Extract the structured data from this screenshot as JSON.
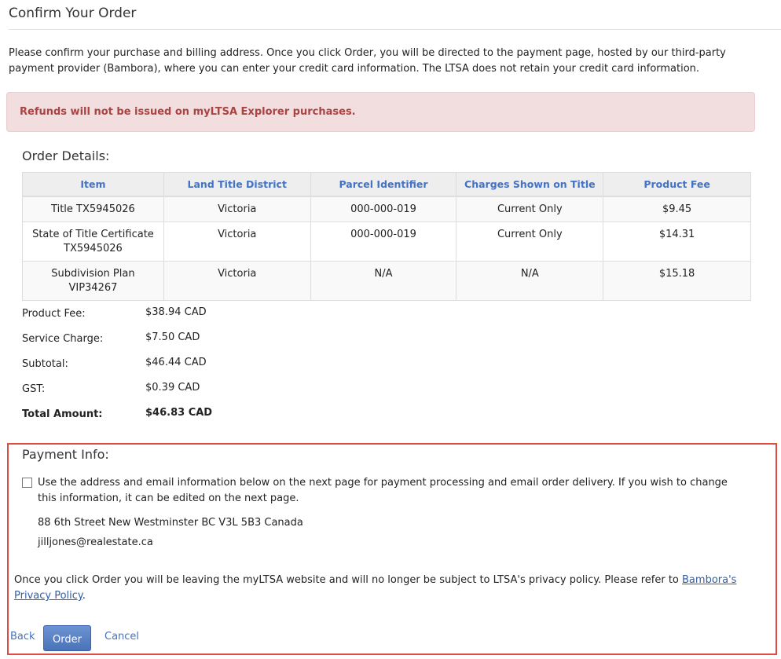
{
  "page": {
    "title": "Confirm Your Order",
    "intro": "Please confirm your purchase and billing address. Once you click Order, you will be directed to the payment page, hosted by our third-party payment provider (Bambora), where you can enter your credit card information. The LTSA does not retain your credit card information."
  },
  "alert": {
    "text": "Refunds will not be issued on myLTSA Explorer purchases.",
    "color": "#a94442",
    "background": "#f2dede"
  },
  "order_details": {
    "heading": "Order Details:",
    "columns": [
      "Item",
      "Land Title District",
      "Parcel Identifier",
      "Charges Shown on Title",
      "Product Fee"
    ],
    "rows": [
      {
        "item": "Title TX5945026",
        "district": "Victoria",
        "pid": "000-000-019",
        "charges": "Current Only",
        "fee": "$9.45"
      },
      {
        "item": "State of Title Certificate TX5945026",
        "district": "Victoria",
        "pid": "000-000-019",
        "charges": "Current Only",
        "fee": "$14.31"
      },
      {
        "item": "Subdivision Plan VIP34267",
        "district": "Victoria",
        "pid": "N/A",
        "charges": "N/A",
        "fee": "$15.18"
      }
    ]
  },
  "summary": {
    "product_fee": {
      "label": "Product Fee:",
      "value": "$38.94 CAD"
    },
    "service_charge": {
      "label": "Service Charge:",
      "value": "$7.50 CAD"
    },
    "subtotal": {
      "label": "Subtotal:",
      "value": "$46.44 CAD"
    },
    "gst": {
      "label": "GST:",
      "value": "$0.39 CAD"
    },
    "total": {
      "label": "Total Amount:",
      "value": "$46.83 CAD"
    }
  },
  "payment_info": {
    "heading": "Payment Info:",
    "checkbox_label": "Use the address and email information below on the next page for payment processing and email order delivery. If you wish to change this information, it can be edited on the next page.",
    "checkbox_checked": false,
    "address": "88 6th Street New Westminster BC V3L 5B3 Canada",
    "email": "jilljones@realestate.ca",
    "privacy_text": "Once you click Order you will be leaving the myLTSA website and will no longer be subject to LTSA's privacy policy. Please refer to ",
    "privacy_link": "Bambora's Privacy Policy",
    "privacy_end": ".",
    "highlight_color": "#e04a45"
  },
  "actions": {
    "back": "Back",
    "order": "Order",
    "cancel": "Cancel"
  }
}
